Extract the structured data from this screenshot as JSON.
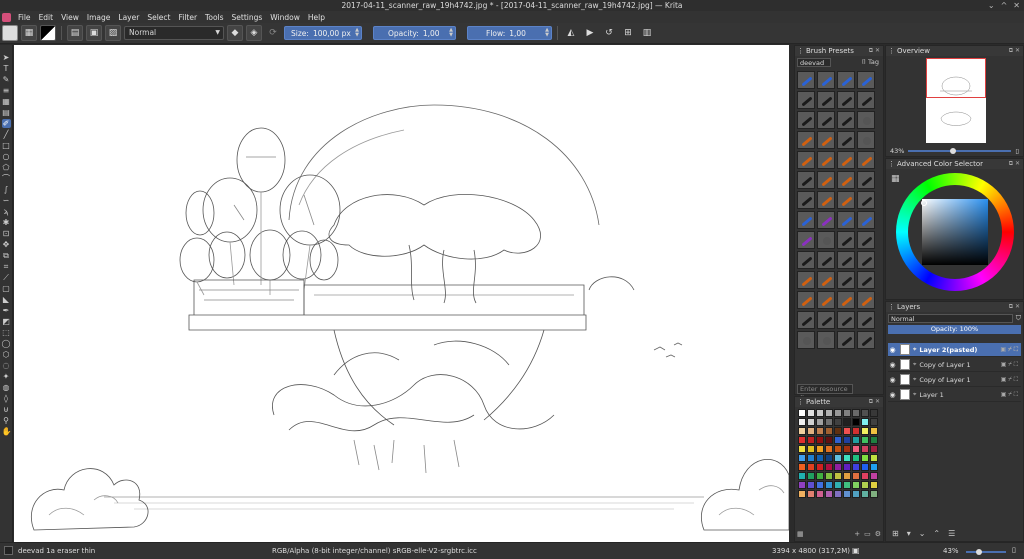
{
  "window": {
    "title": "2017-04-11_scanner_raw_19h4742.jpg * - [2017-04-11_scanner_raw_19h4742.jpg] — Krita",
    "controls": [
      "⌄",
      "^",
      "✕"
    ]
  },
  "menu": [
    "File",
    "Edit",
    "View",
    "Image",
    "Layer",
    "Select",
    "Filter",
    "Tools",
    "Settings",
    "Window",
    "Help"
  ],
  "toolbar": {
    "blend_mode": "Normal",
    "size_label": "Size:",
    "size_value": "100,00 px",
    "opacity_label": "Opacity:",
    "opacity_value": "1,00",
    "flow_label": "Flow:",
    "flow_value": "1,00"
  },
  "brush_presets": {
    "title": "Brush Presets",
    "tag_set": "deevad",
    "tag_label": "Tag",
    "search_placeholder": "Enter resource fi..."
  },
  "overview": {
    "title": "Overview",
    "zoom": "43%"
  },
  "color_selector": {
    "title": "Advanced Color Selector"
  },
  "palette": {
    "title": "Palette",
    "colors": [
      "#ffffff",
      "#e0e0e0",
      "#c8c8c8",
      "#b0b0b0",
      "#989898",
      "#808080",
      "#686868",
      "#505050",
      "#383838",
      "#f0f0f0",
      "#d0d0d0",
      "#a0a0a0",
      "#707070",
      "#404040",
      "#202020",
      "#000000",
      "#80f0f0",
      "#404040",
      "#f0d0a0",
      "#e0b080",
      "#c08050",
      "#a06030",
      "#603010",
      "#f05050",
      "#d03030",
      "#f0f060",
      "#f0c040",
      "#e03030",
      "#c02020",
      "#901010",
      "#601010",
      "#3060d0",
      "#2040a0",
      "#20a0a0",
      "#40c060",
      "#208040",
      "#f0e040",
      "#e0c020",
      "#f0a020",
      "#e07020",
      "#c05010",
      "#a03010",
      "#f06080",
      "#d04060",
      "#a02040",
      "#40a0f0",
      "#2080d0",
      "#1060b0",
      "#104080",
      "#60c0e0",
      "#40e0c0",
      "#20c080",
      "#80e040",
      "#c0e040",
      "#f06020",
      "#e04020",
      "#d02020",
      "#b01040",
      "#9020a0",
      "#6020c0",
      "#4040e0",
      "#2060f0",
      "#20a0f0",
      "#20b0b0",
      "#20a060",
      "#40b040",
      "#80c040",
      "#c0c040",
      "#e0a040",
      "#e07040",
      "#e04060",
      "#c040a0",
      "#9040c0",
      "#6050d0",
      "#4070e0",
      "#3090d0",
      "#30b0b0",
      "#40c080",
      "#80d060",
      "#b0d050",
      "#e0d040",
      "#f0b060",
      "#e08070",
      "#d06090",
      "#b060b0",
      "#8070c0",
      "#6090d0",
      "#50a0c0",
      "#60b0a0",
      "#80b080"
    ]
  },
  "layers": {
    "title": "Layers",
    "blend_mode": "Normal",
    "opacity": "Opacity:  100%",
    "items": [
      {
        "name": "Layer 2(pasted)",
        "selected": true
      },
      {
        "name": "Copy of Layer 1",
        "selected": false
      },
      {
        "name": "Copy of Layer 1",
        "selected": false
      },
      {
        "name": "Layer 1",
        "selected": false
      }
    ]
  },
  "status": {
    "brush": "deevad 1a eraser thin",
    "color_model": "RGB/Alpha (8-bit integer/channel)  sRGB-elle-V2-srgbtrc.icc",
    "dimensions": "3394 x 4800 (317,2M)",
    "zoom": "43%"
  }
}
